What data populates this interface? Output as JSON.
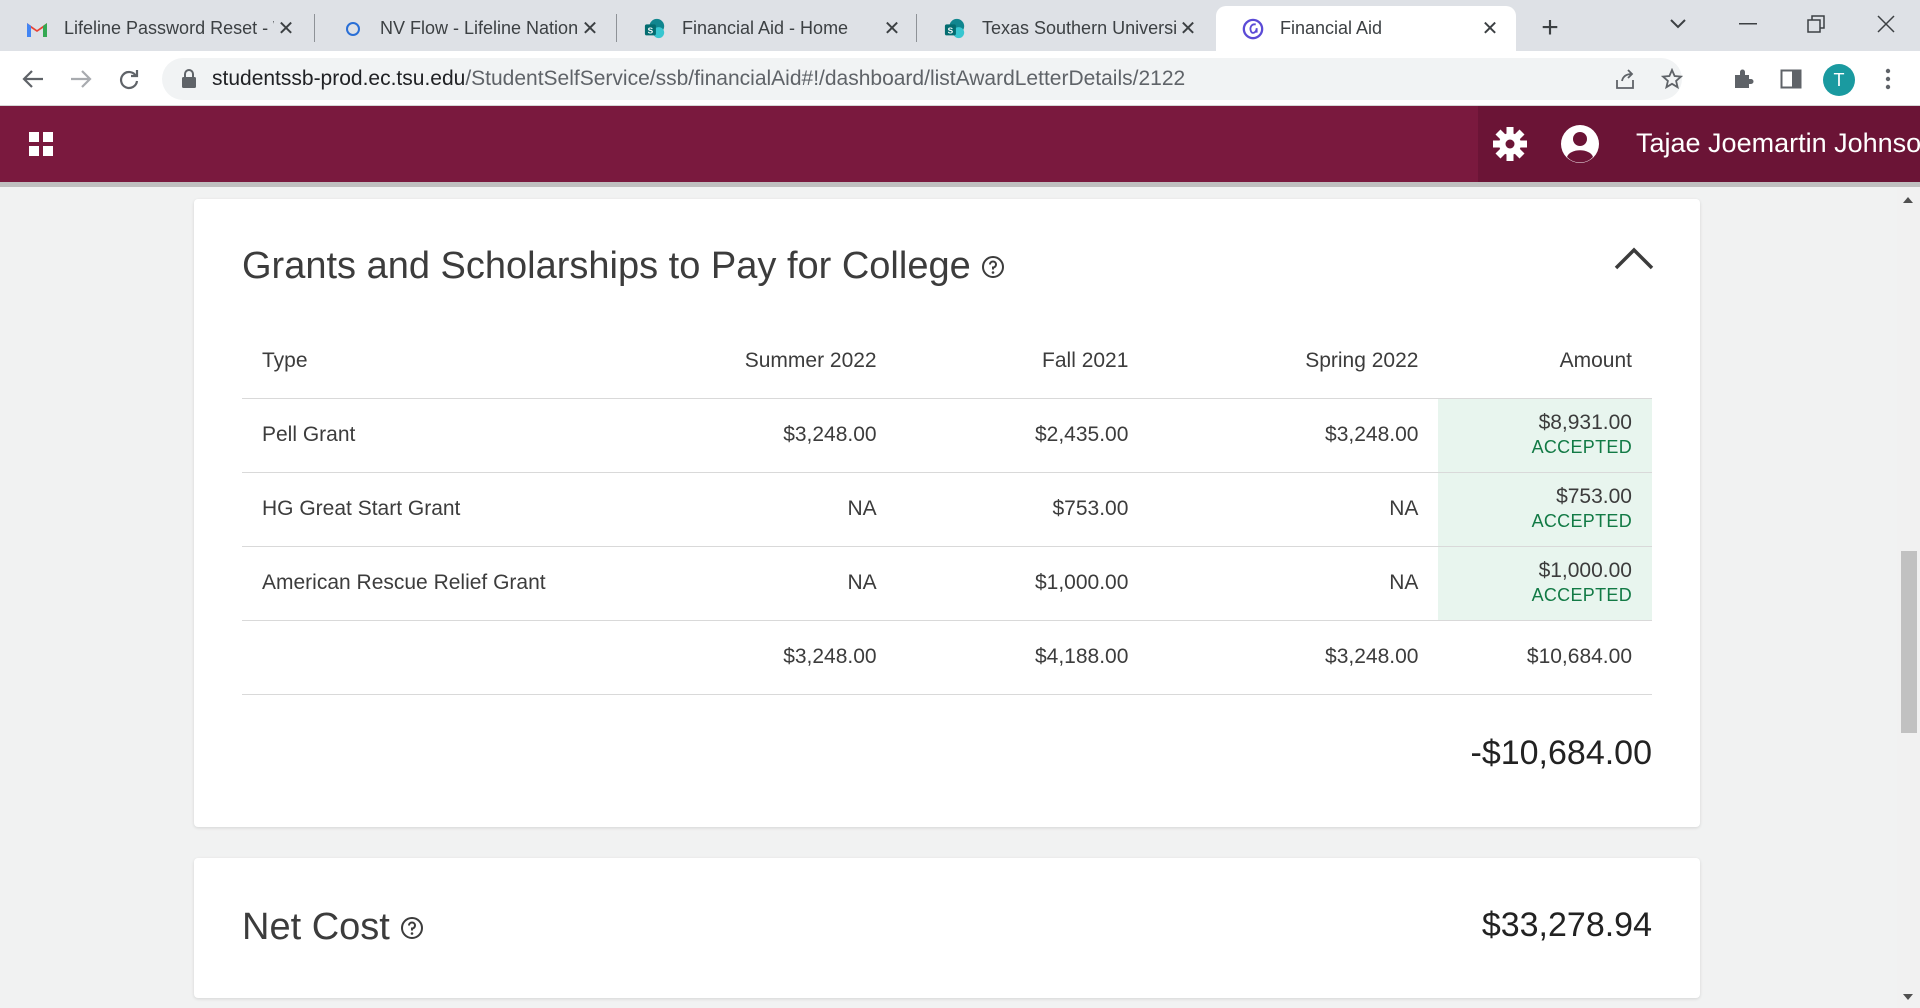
{
  "browser": {
    "tabs": [
      {
        "title": "Lifeline Password Reset - W",
        "icon": "gmail-icon"
      },
      {
        "title": "NV Flow - Lifeline Nationa",
        "icon": "nvflow-icon"
      },
      {
        "title": "Financial Aid - Home",
        "icon": "sharepoint-icon"
      },
      {
        "title": "Texas Southern University",
        "icon": "sharepoint-icon"
      },
      {
        "title": "Financial Aid",
        "icon": "ellucian-icon",
        "active": true
      }
    ],
    "url_host": "studentssb-prod.ec.tsu.edu",
    "url_path": "/StudentSelfService/ssb/financialAid#!/dashboard/listAwardLetterDetails/2122",
    "profile_initial": "T"
  },
  "app_header": {
    "user_name": "Tajae Joemartin Johnson",
    "brand_color": "#7a193e"
  },
  "grants": {
    "title": "Grants and Scholarships to Pay for College",
    "columns": [
      "Type",
      "Summer 2022",
      "Fall 2021",
      "Spring 2022",
      "Amount"
    ],
    "rows": [
      {
        "type": "Pell Grant",
        "summer": "$3,248.00",
        "fall": "$2,435.00",
        "spring": "$3,248.00",
        "amount": "$8,931.00",
        "status": "ACCEPTED"
      },
      {
        "type": "HG Great Start Grant",
        "summer": "NA",
        "fall": "$753.00",
        "spring": "NA",
        "amount": "$753.00",
        "status": "ACCEPTED"
      },
      {
        "type": "American Rescue Relief Grant",
        "summer": "NA",
        "fall": "$1,000.00",
        "spring": "NA",
        "amount": "$1,000.00",
        "status": "ACCEPTED"
      }
    ],
    "totals": {
      "summer": "$3,248.00",
      "fall": "$4,188.00",
      "spring": "$3,248.00",
      "amount": "$10,684.00"
    },
    "grand_total": "-$10,684.00"
  },
  "net_cost": {
    "title": "Net Cost",
    "amount": "$33,278.94"
  }
}
